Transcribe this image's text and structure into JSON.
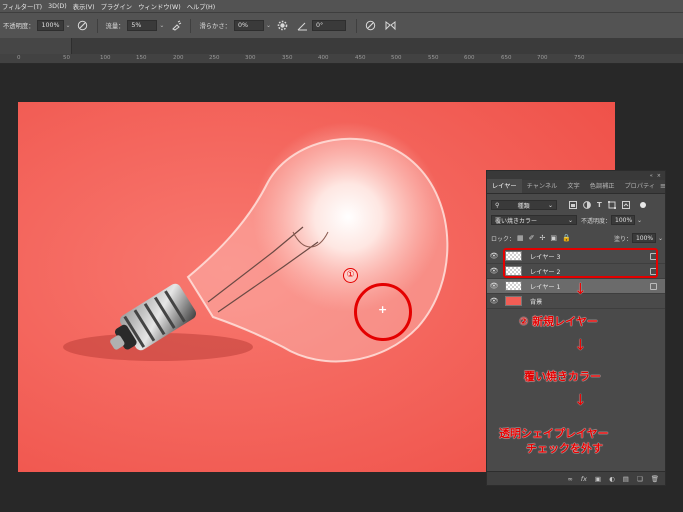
{
  "menu": {
    "items": [
      "フィルター(T)",
      "3D(D)",
      "表示(V)",
      "プラグイン",
      "ウィンドウ(W)",
      "ヘルプ(H)"
    ]
  },
  "options": {
    "opacity_label": "不透明度：",
    "opacity_value": "100%",
    "flow_label": "流量：",
    "flow_value": "5%",
    "smoothing_label": "滑らかさ：",
    "smoothing_value": "0%",
    "angle_value": "0°"
  },
  "ruler": {
    "labels": [
      "0",
      "50",
      "100",
      "150",
      "200",
      "250",
      "300",
      "350",
      "400",
      "450",
      "500",
      "550",
      "600",
      "650",
      "700",
      "750"
    ]
  },
  "layers_panel": {
    "tabs": [
      "レイヤー",
      "チャンネル",
      "文字",
      "色調補正",
      "プロパティ"
    ],
    "active_tab": "レイヤー",
    "search_kind": "種類",
    "blend_mode": "覆い焼きカラー",
    "opacity_label": "不透明度：",
    "opacity_value": "100%",
    "lock_label": "ロック：",
    "fill_label": "塗り：",
    "fill_value": "100%",
    "layers": [
      {
        "name": "レイヤー 3",
        "selected": false
      },
      {
        "name": "レイヤー 2",
        "selected": false
      },
      {
        "name": "レイヤー 1",
        "selected": true
      },
      {
        "name": "背景",
        "selected": false
      }
    ]
  },
  "annotations": {
    "step1": "①",
    "step2": "② 新規レイヤー",
    "step3": "覆い焼きカラー",
    "step4_line1": "透明シェイプレイヤー",
    "step4_line2": "チェックを外す",
    "arrow": "↓"
  },
  "colors": {
    "image_background": "#f25d55",
    "annotation_red": "#e40000",
    "panel_bg": "#4a4a4a"
  }
}
